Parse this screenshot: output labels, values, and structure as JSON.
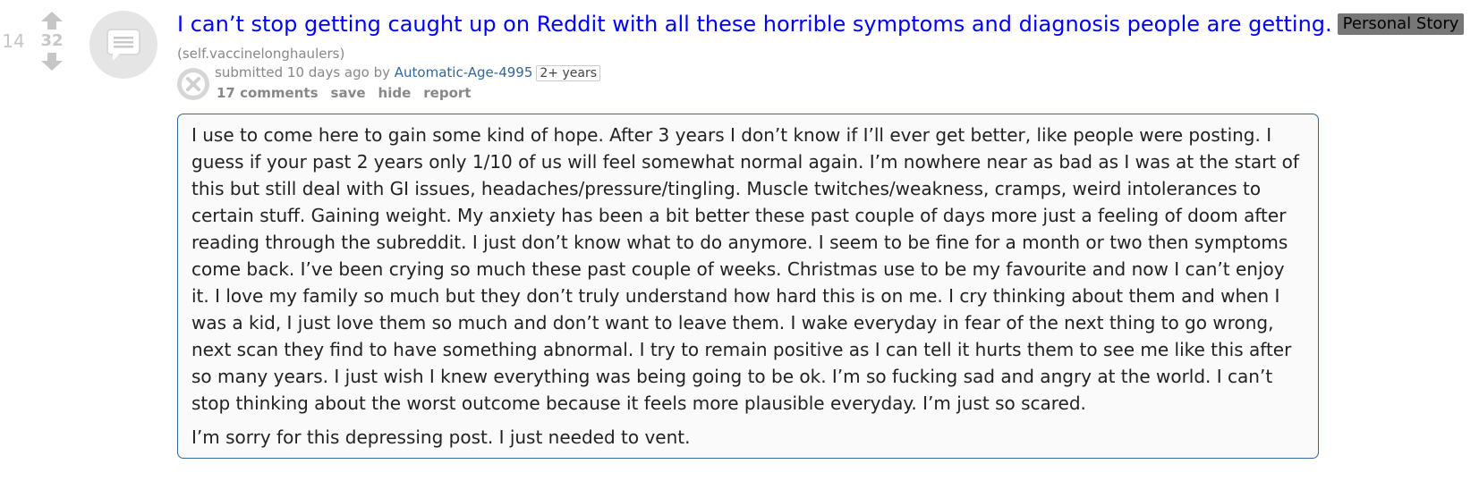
{
  "post": {
    "rank": "14",
    "score": "32",
    "title": "I can’t stop getting caught up on Reddit with all these horrible symptoms and diagnosis people are getting.",
    "flair": "Personal Story",
    "domain": "(self.vaccinelonghaulers)",
    "submitted_prefix": "submitted ",
    "time": "10 days ago",
    "by": " by ",
    "author": "Automatic-Age-4995",
    "author_badge": "2+ years",
    "actions": {
      "comments": "17 comments",
      "save": "save",
      "hide": "hide",
      "report": "report"
    },
    "body": [
      "I use to come here to gain some kind of hope. After 3 years I don’t know if I’ll ever get better, like people were posting. I guess if your past 2 years only 1/10 of us will feel somewhat normal again. I’m nowhere near as bad as I was at the start of this but still deal with GI issues, headaches/pressure/tingling. Muscle twitches/weakness, cramps, weird intolerances to certain stuff. Gaining weight. My anxiety has been a bit better these past couple of days more just a feeling of doom after reading through the subreddit. I just don’t know what to do anymore. I seem to be fine for a month or two then symptoms come back. I’ve been crying so much these past couple of weeks. Christmas use to be my favourite and now I can’t enjoy it. I love my family so much but they don’t truly understand how hard this is on me. I cry thinking about them and when I was a kid, I just love them so much and don’t want to leave them. I wake everyday in fear of the next thing to go wrong, next scan they find to have something abnormal. I try to remain positive as I can tell it hurts them to see me like this after so many years. I just wish I knew everything was being going to be ok. I’m so fucking sad and angry at the world. I can’t stop thinking about the worst outcome because it feels more plausible everyday. I’m just so scared.",
      "I’m sorry for this depressing post. I just needed to vent."
    ]
  },
  "icons": {
    "upvote": "upvote-arrow-icon",
    "downvote": "downvote-arrow-icon",
    "thumbnail": "self-post-text-icon",
    "close": "close-x-icon"
  },
  "colors": {
    "title_link": "#0000ff",
    "author_link": "#336699",
    "body_border": "#336699",
    "body_bg": "#fafafa",
    "muted": "#888888"
  }
}
